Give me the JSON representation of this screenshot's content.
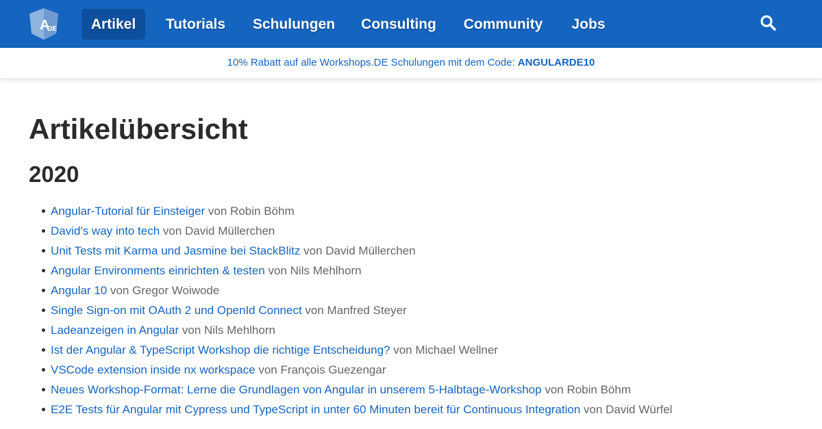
{
  "navbar": {
    "logo_text": "A DE",
    "items": [
      {
        "label": "Artikel",
        "active": true
      },
      {
        "label": "Tutorials",
        "active": false
      },
      {
        "label": "Schulungen",
        "active": false
      },
      {
        "label": "Consulting",
        "active": false
      },
      {
        "label": "Community",
        "active": false
      },
      {
        "label": "Jobs",
        "active": false
      }
    ],
    "search_icon": "search-icon"
  },
  "promo": {
    "text": "10% Rabatt auf alle Workshops.DE Schulungen mit dem Code: ",
    "code": "ANGULARDE10"
  },
  "page": {
    "title": "Artikelübersicht",
    "year": "2020"
  },
  "articles": [
    {
      "title": "Angular-Tutorial für Einsteiger",
      "author": " von Robin Böhm"
    },
    {
      "title": "David's way into tech",
      "author": " von David Müllerchen"
    },
    {
      "title": "Unit Tests mit Karma und Jasmine bei StackBlitz",
      "author": " von David Müllerchen"
    },
    {
      "title": "Angular Environments einrichten & testen",
      "author": " von Nils Mehlhorn"
    },
    {
      "title": "Angular 10",
      "author": " von Gregor Woiwode"
    },
    {
      "title": "Single Sign-on mit OAuth 2 und OpenId Connect",
      "author": " von Manfred Steyer"
    },
    {
      "title": "Ladeanzeigen in Angular",
      "author": " von Nils Mehlhorn"
    },
    {
      "title": "Ist der Angular & TypeScript Workshop die richtige Entscheidung?",
      "author": " von Michael Wellner"
    },
    {
      "title": "VSCode extension inside nx workspace",
      "author": " von François Guezengar"
    },
    {
      "title": "Neues Workshop-Format: Lerne die Grundlagen von Angular in unserem 5-Halbtage-Workshop",
      "author": " von Robin Böhm"
    },
    {
      "title": "E2E Tests für Angular mit Cypress und TypeScript in unter 60 Minuten bereit für Continuous Integration",
      "author": " von David Würfel"
    }
  ],
  "colors": {
    "brand": "#1565c0",
    "active_nav": "#0e4f9d",
    "link": "#1565c0",
    "text": "#2b2b2b",
    "muted": "#666666"
  }
}
